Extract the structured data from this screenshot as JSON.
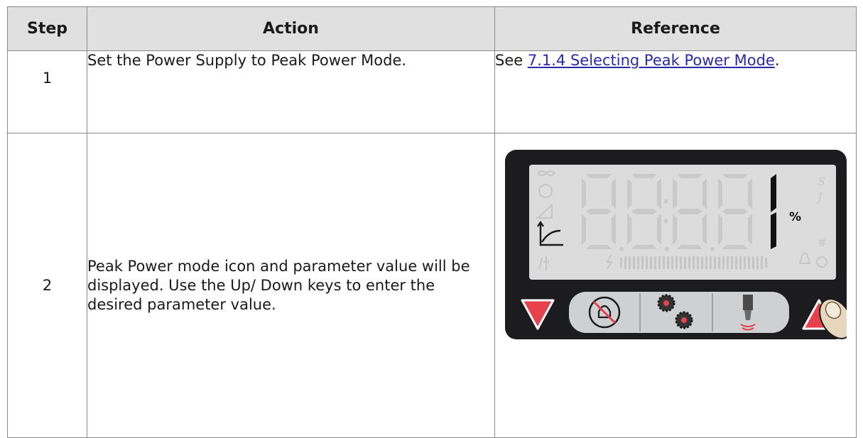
{
  "table": {
    "headers": [
      "Step",
      "Action",
      "Reference"
    ],
    "rows": [
      {
        "step": "1",
        "action": "Set the Power Supply to Peak Power Mode.",
        "reference_prefix": "See ",
        "reference_link": "7.1.4 Selecting Peak Power Mode",
        "reference_suffix": "."
      },
      {
        "step": "2",
        "action": "Peak Power mode icon and parameter value will be displayed. Use the Up/ Down keys to enter the desired parameter value."
      }
    ]
  },
  "display": {
    "value": "1",
    "unit": "%",
    "ghost_units": [
      "S",
      "J",
      "#"
    ],
    "active_icon": "peak-power-mode-icon",
    "buttons": [
      "down-arrow-button",
      "alarm-reset-button",
      "setup-gears-button",
      "horn-test-button",
      "up-arrow-button"
    ],
    "colors": {
      "bezel": "#1c1c1e",
      "lcd": "#dcdcdc",
      "arrow": "#e8414e",
      "key": "#cfd0d2"
    }
  }
}
